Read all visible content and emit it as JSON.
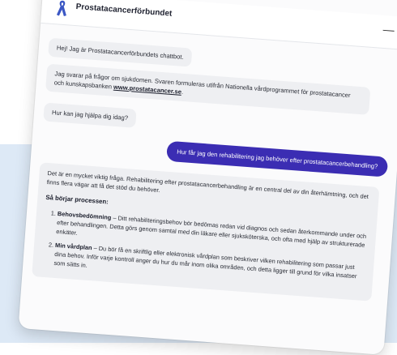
{
  "header": {
    "org_name": "Prostatacancerförbundet",
    "minimize_label": "—",
    "logo_icon": "awareness-ribbon-icon",
    "logo_color": "#3b57c4"
  },
  "messages": {
    "greeting": "Hej! Jag är Prostatacancerförbundets chattbot.",
    "intro_text": "Jag svarar på frågor om sjukdomen. Svaren formuleras utifrån Nationella vårdprogrammet för prostatacancer och kunskapsbanken ",
    "intro_link": "www.prostatacancer.se",
    "intro_end": ".",
    "question": "Hur kan jag hjälpa dig idag?",
    "user_message": "Hur får jag den rehabilitering jag behöver efter prostatacancerbehandling?",
    "answer_intro": "Det är en mycket viktig fråga. Rehabilitering efter prostatacancerbehandling är en central del av din återhämtning, och det finns flera vägar att få det stöd du behöver.",
    "answer_heading": "Så börjar processen:",
    "steps": [
      {
        "title": "Behovsbedömning",
        "text": " – Ditt rehabiliteringsbehov bör bedömas redan vid diagnos och sedan återkommande under och efter behandlingen. Detta görs genom samtal med din läkare eller sjuksköterska, och ofta med hjälp av strukturerade enkäter."
      },
      {
        "title": "Min vårdplan",
        "text": " – Du bör få en skriftlig eller elektronisk vårdplan som beskriver vilken rehabilitering som passar just dina behov. Inför varje kontroll anger du hur du mår inom olika områden, och detta ligger till grund för vilka insatser som sätts in."
      }
    ]
  },
  "colors": {
    "user_bubble": "#3b2db3",
    "bot_bubble": "#eeeff2",
    "background_band": "#dde9f6"
  }
}
